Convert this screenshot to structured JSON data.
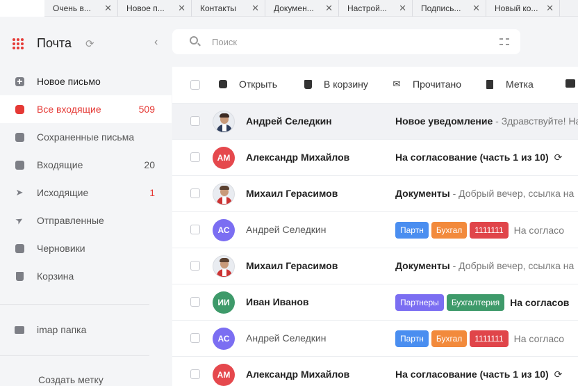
{
  "browser_tabs": [
    {
      "label": "Очень в...",
      "active": false
    },
    {
      "label": "Новое п...",
      "active": false
    },
    {
      "label": "Контакты",
      "active": false
    },
    {
      "label": "Докумен...",
      "active": false
    },
    {
      "label": "Настрой...",
      "active": false
    },
    {
      "label": "Подпись...",
      "active": false
    },
    {
      "label": "Новый ко...",
      "active": false
    }
  ],
  "sidebar": {
    "title": "Почта",
    "compose_label": "Новое письмо",
    "items": [
      {
        "label": "Все входящие",
        "count": "509",
        "icon": "inbox-all-icon",
        "active": true
      },
      {
        "label": "Сохраненные письма",
        "count": "",
        "icon": "saved-icon"
      },
      {
        "label": "Входящие",
        "count": "20",
        "icon": "inbox-icon"
      },
      {
        "label": "Исходящие",
        "count": "1",
        "icon": "outgoing-icon"
      },
      {
        "label": "Отправленные",
        "count": "",
        "icon": "sent-icon"
      },
      {
        "label": "Черновики",
        "count": "",
        "icon": "drafts-icon"
      },
      {
        "label": "Корзина",
        "count": "",
        "icon": "trash-icon"
      }
    ],
    "folder_label": "imap папка",
    "create_tag_label": "Создать метку"
  },
  "search": {
    "placeholder": "Поиск"
  },
  "toolbar": {
    "open": "Открыть",
    "trash": "В корзину",
    "read": "Прочитано",
    "tag": "Метка"
  },
  "colors": {
    "accent": "#e53935",
    "tag_blue": "#4a8ef0",
    "tag_orange": "#f28a3c",
    "tag_red": "#e0454a",
    "tag_purple": "#7b6ef2",
    "tag_green": "#3e9a6a"
  },
  "emails": [
    {
      "sender": "Андрей Селедкин",
      "avatar": "photo",
      "subject": "Новое уведомление",
      "preview": " - Здравствуйте! На",
      "bold": true,
      "selected": true
    },
    {
      "sender": "Александр Михайлов",
      "avatar": "АМ",
      "avatar_color": "#e5484d",
      "subject": "На согласование (часть 1 из 10)",
      "preview": "",
      "sync": true,
      "bold": true
    },
    {
      "sender": "Михаил Герасимов",
      "avatar": "photo2",
      "subject": "Документы",
      "preview": " - Добрый вечер, ссылка на",
      "bold": true
    },
    {
      "sender": "Андрей Селедкин",
      "avatar": "АС",
      "avatar_color": "#7b6ef2",
      "tags": [
        {
          "t": "Партн",
          "c": "tag_blue"
        },
        {
          "t": "Бухгал",
          "c": "tag_orange"
        },
        {
          "t": "1111111",
          "c": "tag_red"
        }
      ],
      "tag_text": "На согласо",
      "bold": false
    },
    {
      "sender": "Михаил Герасимов",
      "avatar": "photo2",
      "subject": "Документы",
      "preview": " - Добрый вечер, ссылка на",
      "bold": true
    },
    {
      "sender": "Иван Иванов",
      "avatar": "ИИ",
      "avatar_color": "#3e9a6a",
      "tags": [
        {
          "t": "Партнеры",
          "c": "tag_purple"
        },
        {
          "t": "Бухгалтерия",
          "c": "tag_green"
        }
      ],
      "tag_text": "На согласов",
      "tag_bold": true,
      "bold": true
    },
    {
      "sender": "Андрей Селедкин",
      "avatar": "АС",
      "avatar_color": "#7b6ef2",
      "tags": [
        {
          "t": "Партн",
          "c": "tag_blue"
        },
        {
          "t": "Бухгал",
          "c": "tag_orange"
        },
        {
          "t": "1111111",
          "c": "tag_red"
        }
      ],
      "tag_text": "На согласо",
      "bold": false
    },
    {
      "sender": "Александр Михайлов",
      "avatar": "АМ",
      "avatar_color": "#e5484d",
      "subject": "На согласование (часть 1 из 10)",
      "preview": "",
      "sync": true,
      "bold": true
    }
  ]
}
